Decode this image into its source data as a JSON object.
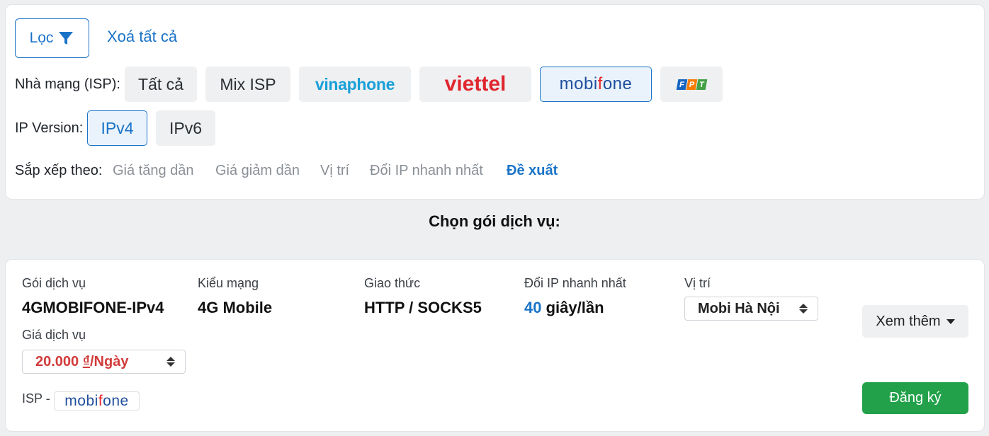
{
  "filter": {
    "button_label": "Lọc",
    "clear_all": "Xoá tất cả"
  },
  "isp": {
    "label": "Nhà mạng (ISP):",
    "options": [
      {
        "label": "Tất cả",
        "kind": "text"
      },
      {
        "label": "Mix ISP",
        "kind": "text"
      },
      {
        "label": "vinaphone",
        "kind": "logo"
      },
      {
        "label": "viettel",
        "kind": "logo"
      },
      {
        "label": "mobifone",
        "kind": "logo",
        "selected": true
      },
      {
        "label": "FPT",
        "kind": "logo"
      }
    ]
  },
  "ip_version": {
    "label": "IP Version:",
    "options": [
      "IPv4",
      "IPv6"
    ],
    "selected": "IPv4"
  },
  "sort": {
    "label": "Sắp xếp theo:",
    "options": [
      "Giá tăng dần",
      "Giá giảm dần",
      "Vị trí",
      "Đổi IP nhanh nhất",
      "Đề xuất"
    ],
    "selected": "Đề xuất"
  },
  "section_title": "Chọn gói dịch vụ:",
  "package": {
    "service_label": "Gói dịch vụ",
    "service_value": "4GMOBIFONE-IPv4",
    "network_label": "Kiểu mạng",
    "network_value": "4G Mobile",
    "protocol_label": "Giao thức",
    "protocol_value": "HTTP / SOCKS5",
    "fastest_label": "Đổi IP nhanh nhất",
    "fastest_number": "40",
    "fastest_unit": "giây/lần",
    "location_label": "Vị trí",
    "location_value": "Mobi Hà Nội",
    "price_label": "Giá dịch vụ",
    "price_value": "20.000",
    "price_currency": "₫",
    "price_period": "/Ngày",
    "isp_label": "ISP -",
    "isp_logo": "mobifone",
    "more_label": "Xem thêm",
    "register_label": "Đăng ký"
  },
  "colors": {
    "accent": "#1a73c7",
    "price": "#d23c3c",
    "register": "#22a14a",
    "viettel": "#e0262e",
    "vinaphone": "#19a0d8",
    "mobifone_blue": "#1f4f9d",
    "mobifone_red": "#e5262a"
  }
}
